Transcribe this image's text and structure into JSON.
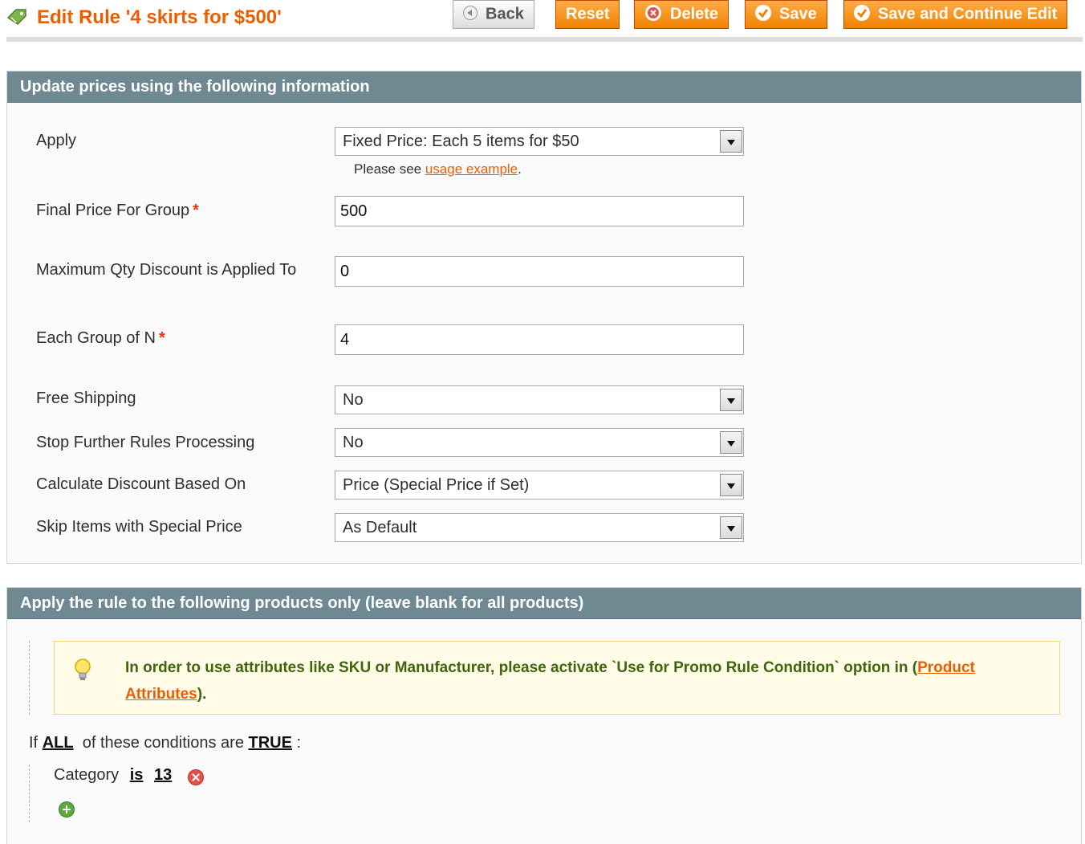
{
  "header": {
    "title": "Edit Rule '4 skirts for $500'",
    "buttons": {
      "back": "Back",
      "reset": "Reset",
      "delete": "Delete",
      "save": "Save",
      "save_continue": "Save and Continue Edit"
    }
  },
  "prices_section": {
    "title": "Update prices using the following information",
    "apply": {
      "label": "Apply",
      "value": "Fixed Price: Each 5 items for $50",
      "note_prefix": "Please see ",
      "note_link": "usage example",
      "note_suffix": "."
    },
    "final_price": {
      "label": "Final Price For Group",
      "required": "*",
      "value": "500"
    },
    "max_qty": {
      "label": "Maximum Qty Discount is Applied To",
      "value": "0"
    },
    "each_group": {
      "label": "Each Group of N",
      "required": "*",
      "value": "4"
    },
    "free_shipping": {
      "label": "Free Shipping",
      "value": "No"
    },
    "stop_rules": {
      "label": "Stop Further Rules Processing",
      "value": "No"
    },
    "calc_based": {
      "label": "Calculate Discount Based On",
      "value": "Price (Special Price if Set)"
    },
    "skip_special": {
      "label": "Skip Items with Special Price",
      "value": "As Default"
    }
  },
  "conditions_section": {
    "title": "Apply the rule to the following products only (leave blank for all products)",
    "info": {
      "text_main": "In order to use attributes like SKU or Manufacturer, please activate `Use for Promo Rule Condition` option in (",
      "link": "Product Attributes",
      "text_end": ")."
    },
    "condition": {
      "prefix": "If",
      "aggregator": "ALL",
      "middle": "of these conditions are",
      "value": "TRUE",
      "suffix": ":"
    },
    "item": {
      "attribute": "Category",
      "operator": "is",
      "value": "13"
    }
  },
  "colors": {
    "accent": "#eb5e00",
    "section_header": "#6f8992",
    "info_text": "#3d6611"
  }
}
